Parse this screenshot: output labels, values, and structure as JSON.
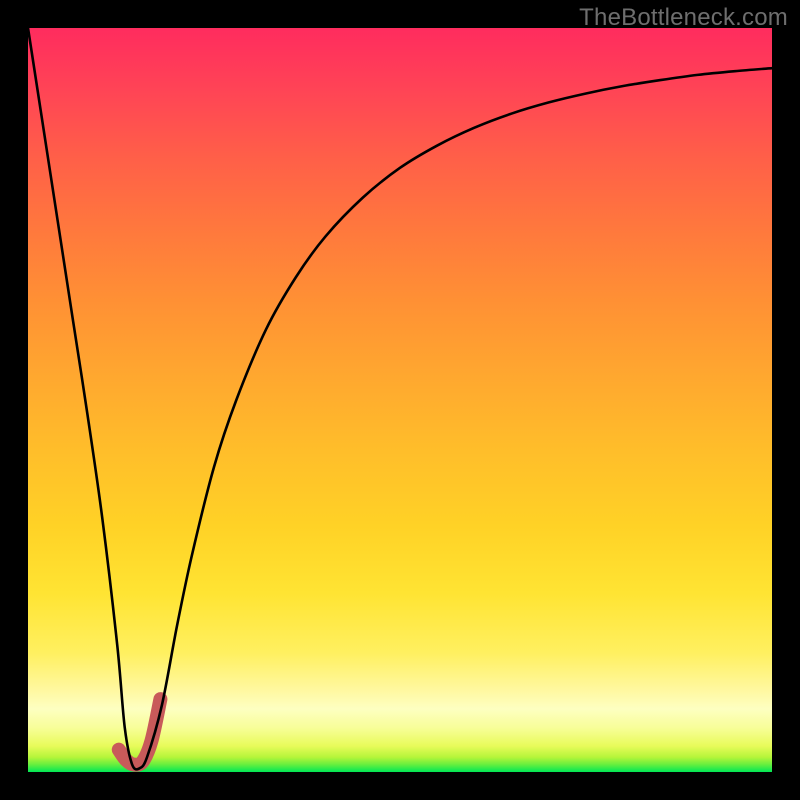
{
  "watermark": "TheBottleneck.com",
  "chart_data": {
    "type": "line",
    "title": "",
    "xlabel": "",
    "ylabel": "",
    "xlim": [
      0,
      100
    ],
    "ylim": [
      0,
      100
    ],
    "x": [
      0,
      2,
      4,
      6,
      8,
      10,
      12,
      13,
      14,
      15,
      16,
      18,
      20,
      22,
      25,
      28,
      32,
      36,
      40,
      45,
      50,
      55,
      60,
      65,
      70,
      75,
      80,
      85,
      90,
      95,
      100
    ],
    "values": [
      100,
      87,
      74,
      61,
      48,
      34,
      17,
      6,
      1,
      0.5,
      2,
      9,
      19.5,
      29,
      41,
      50,
      59.5,
      66.5,
      72,
      77.2,
      81.2,
      84.2,
      86.6,
      88.5,
      90,
      91.2,
      92.2,
      93,
      93.7,
      94.2,
      94.6
    ],
    "highlight": {
      "x": [
        12.2,
        13.2,
        14.2,
        15.4,
        16.6,
        17.8
      ],
      "values": [
        3,
        1.6,
        1.0,
        1.4,
        4.2,
        9.8
      ]
    },
    "colors": {
      "curve": "#000000",
      "highlight": "#c85a5a"
    }
  }
}
